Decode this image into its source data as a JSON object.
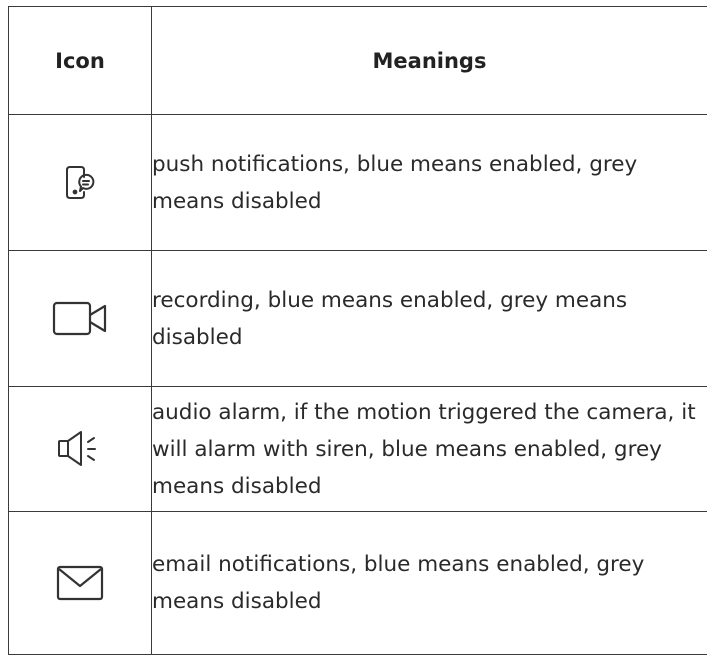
{
  "table": {
    "headers": {
      "icon": "Icon",
      "meanings": "Meanings"
    },
    "rows": [
      {
        "icon": "phone-notification-icon",
        "meaning": "push notifications, blue means enabled, grey means disabled"
      },
      {
        "icon": "video-camera-icon",
        "meaning": "recording, blue means enabled, grey means disabled"
      },
      {
        "icon": "speaker-alarm-icon",
        "meaning": "audio alarm, if the motion triggered the camera, it will alarm with siren, blue means enabled, grey means disabled"
      },
      {
        "icon": "envelope-icon",
        "meaning": "email notifications, blue means enabled, grey means disabled"
      }
    ]
  },
  "colors": {
    "border": "#3a3a3a",
    "text": "#2a2a2a",
    "icon_stroke": "#333333"
  }
}
